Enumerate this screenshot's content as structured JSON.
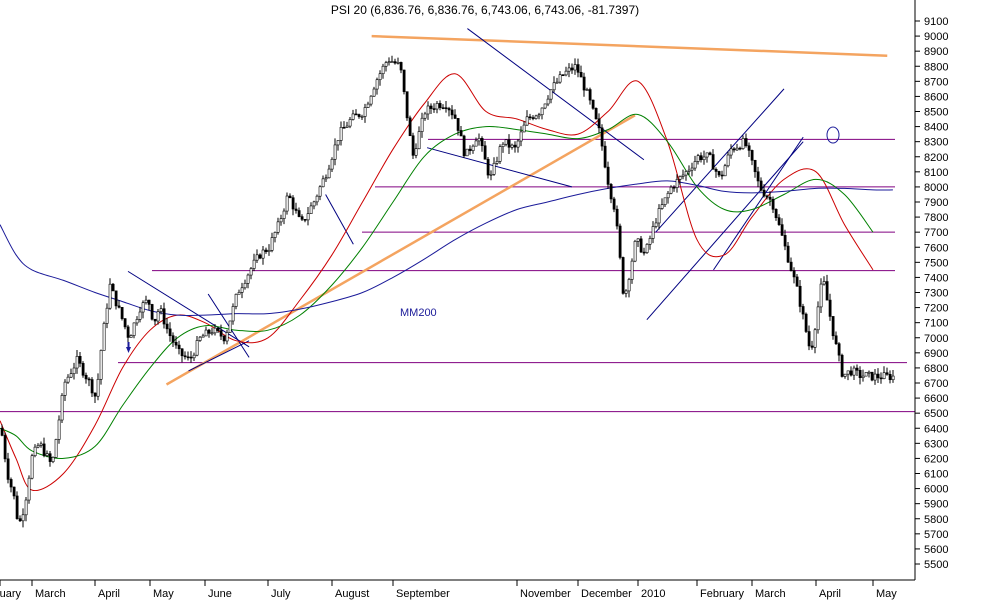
{
  "chart_data": {
    "type": "line",
    "title": "PSI 20 (6,836.76, 6,836.76, 6,743.06, 6,743.06, -81.7397)",
    "xlabel": "",
    "ylabel": "",
    "ylim": [
      5400,
      9200
    ],
    "y_ticks": [
      5500,
      5600,
      5700,
      5800,
      5900,
      6000,
      6100,
      6200,
      6300,
      6400,
      6500,
      6600,
      6700,
      6800,
      6900,
      7000,
      7100,
      7200,
      7300,
      7400,
      7500,
      7600,
      7700,
      7800,
      7900,
      8000,
      8100,
      8200,
      8300,
      8400,
      8500,
      8600,
      8700,
      8800,
      8900,
      9000,
      9100
    ],
    "x_ticks": [
      "ruary",
      "March",
      "April",
      "May",
      "June",
      "July",
      "August",
      "September",
      "November",
      "December",
      "2010",
      "February",
      "March",
      "April",
      "May"
    ],
    "x_tick_pos": [
      0.0,
      1.0,
      2.0,
      3.0,
      4.0,
      5.0,
      6.0,
      7.0,
      9.0,
      10.0,
      11.0,
      12.0,
      13.0,
      14.0,
      15.0
    ],
    "xlim": [
      0.0,
      15.72
    ],
    "grid": false,
    "legend": "none",
    "series": [
      {
        "role": "price",
        "color": "#000000",
        "x": [
          0.0,
          0.2,
          0.4,
          0.55,
          0.75,
          0.95,
          1.1,
          1.3,
          1.5,
          1.7,
          1.9,
          2.0,
          2.1,
          2.25,
          2.45,
          2.6,
          2.8,
          2.95,
          3.05,
          3.15,
          3.3,
          3.5,
          3.7,
          3.9,
          4.1,
          4.3,
          4.5,
          4.7,
          4.85,
          5.0,
          5.15,
          5.3,
          5.5,
          5.7,
          5.9,
          6.1,
          6.3,
          6.5,
          6.7,
          6.9,
          7.1,
          7.3,
          7.5,
          7.7,
          7.85,
          8.0,
          8.15,
          8.35,
          8.55,
          8.75,
          8.95,
          9.15,
          9.35,
          9.55,
          9.75,
          9.95,
          10.15,
          10.35,
          10.5,
          10.6,
          10.75,
          10.95,
          11.1,
          11.3,
          11.55,
          11.8,
          12.0,
          12.2,
          12.4,
          12.6,
          12.85,
          13.1,
          13.3,
          13.5,
          13.7,
          13.9,
          14.1,
          14.3,
          14.45,
          14.6,
          14.75,
          14.85,
          14.95,
          15.05,
          15.15,
          15.25,
          15.35
        ],
        "values": [
          6400,
          6100,
          5950,
          5750,
          5900,
          6200,
          6300,
          6150,
          6700,
          6850,
          6700,
          6600,
          6950,
          7350,
          7150,
          7000,
          7200,
          7250,
          7100,
          7200,
          7050,
          6900,
          6850,
          7000,
          7050,
          7000,
          7300,
          7450,
          7550,
          7600,
          7750,
          7950,
          7750,
          7900,
          8100,
          8350,
          8450,
          8500,
          8700,
          8850,
          8800,
          8200,
          8500,
          8550,
          8550,
          8450,
          8200,
          8350,
          8050,
          8300,
          8250,
          8450,
          8500,
          8650,
          8750,
          8800,
          8600,
          8350,
          8000,
          7850,
          7250,
          7650,
          7550,
          7800,
          8000,
          8100,
          8200,
          8200,
          8050,
          8250,
          8300,
          8000,
          7900,
          7600,
          7300,
          6900,
          7400,
          7000,
          6750,
          6780,
          6750,
          6750,
          6743,
          6743,
          6743,
          6743,
          6743
        ]
      },
      {
        "role": "moving-average-short",
        "color": "#cc0000",
        "x": [
          0.0,
          0.5,
          1.0,
          1.5,
          2.0,
          2.5,
          3.0,
          3.5,
          4.0,
          4.5,
          5.0,
          5.5,
          6.0,
          6.5,
          7.0,
          7.5,
          8.0,
          8.5,
          9.0,
          9.5,
          10.0,
          10.5,
          11.0,
          11.5,
          12.0,
          12.5,
          13.0,
          13.5,
          14.0,
          14.5,
          15.0
        ],
        "values": [
          6450,
          6200,
          5990,
          6100,
          6420,
          6800,
          7050,
          7150,
          7100,
          6980,
          7000,
          7250,
          7550,
          7900,
          8250,
          8550,
          8750,
          8500,
          8450,
          8380,
          8350,
          8500,
          8700,
          8300,
          7650,
          7550,
          7800,
          8050,
          8100,
          7750,
          7450
        ]
      },
      {
        "role": "moving-average-medium",
        "color": "#008000",
        "x": [
          0.0,
          0.5,
          1.0,
          1.5,
          2.0,
          2.5,
          3.0,
          3.5,
          4.0,
          4.5,
          5.0,
          5.5,
          6.0,
          6.5,
          7.0,
          7.5,
          8.0,
          8.5,
          9.0,
          9.5,
          10.0,
          10.5,
          11.0,
          11.5,
          12.0,
          12.5,
          13.0,
          13.5,
          14.0,
          14.5,
          15.0
        ],
        "values": [
          6400,
          6350,
          6250,
          6200,
          6280,
          6550,
          6800,
          7000,
          7080,
          7050,
          7050,
          7150,
          7350,
          7600,
          7900,
          8200,
          8350,
          8400,
          8380,
          8350,
          8320,
          8380,
          8480,
          8300,
          8000,
          7850,
          7850,
          7950,
          8050,
          7950,
          7700
        ]
      },
      {
        "role": "moving-average-200",
        "color": "#1a1a99",
        "x": [
          0.0,
          0.5,
          1.0,
          1.5,
          2.0,
          2.5,
          3.0,
          3.5,
          4.0,
          4.5,
          5.0,
          5.5,
          6.0,
          6.5,
          7.0,
          7.5,
          8.0,
          8.5,
          9.0,
          9.5,
          10.0,
          10.5,
          11.0,
          11.5,
          12.0,
          12.5,
          13.0,
          13.5,
          14.0,
          14.5,
          15.0,
          15.35
        ],
        "values": [
          7750,
          7550,
          7450,
          7380,
          7300,
          7240,
          7180,
          7150,
          7150,
          7160,
          7160,
          7190,
          7240,
          7300,
          7400,
          7520,
          7650,
          7760,
          7850,
          7900,
          7950,
          7990,
          8020,
          8040,
          8010,
          7970,
          7960,
          7970,
          7990,
          7990,
          7980,
          7980
        ]
      }
    ],
    "annotations": {
      "ma200_label": "MM200",
      "horizontal_levels": [
        8315,
        8000,
        7700,
        7445,
        6835,
        6510
      ],
      "trendlines": [
        {
          "color": "#f4a460",
          "x": [
            6.65,
            15.25
          ],
          "y": [
            9000,
            8870
          ]
        },
        {
          "color": "#f4a460",
          "x": [
            3.3,
            10.95
          ],
          "y": [
            6690,
            8475
          ]
        },
        {
          "color": "#000080",
          "x": [
            8.2,
            11.1
          ],
          "y": [
            9050,
            8180
          ]
        },
        {
          "color": "#000080",
          "x": [
            7.55,
            9.9
          ],
          "y": [
            8260,
            8000
          ]
        },
        {
          "color": "#000080",
          "x": [
            2.6,
            4.7
          ],
          "y": [
            7440,
            6940
          ]
        },
        {
          "color": "#000080",
          "x": [
            3.7,
            4.7
          ],
          "y": [
            6780,
            6980
          ]
        },
        {
          "color": "#000080",
          "x": [
            4.05,
            4.7
          ],
          "y": [
            7290,
            6870
          ]
        },
        {
          "color": "#000080",
          "x": [
            5.9,
            6.35
          ],
          "y": [
            7950,
            7620
          ]
        },
        {
          "color": "#000080",
          "x": [
            11.15,
            13.8
          ],
          "y": [
            7120,
            8300
          ]
        },
        {
          "color": "#000080",
          "x": [
            11.3,
            13.5
          ],
          "y": [
            7700,
            8650
          ]
        },
        {
          "color": "#000080",
          "x": [
            12.3,
            13.8
          ],
          "y": [
            7450,
            8330
          ]
        }
      ]
    }
  }
}
